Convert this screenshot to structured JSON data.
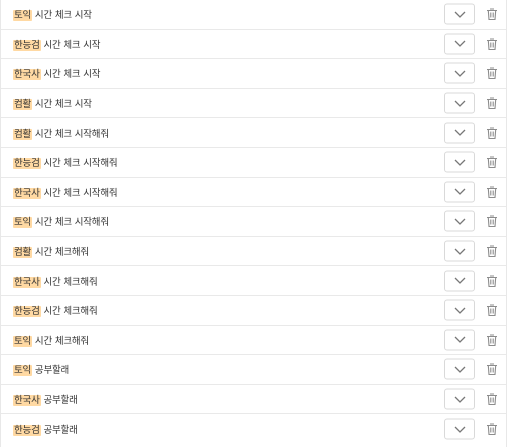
{
  "items": [
    {
      "tag": "토익",
      "text": " 시간 체크 시작"
    },
    {
      "tag": "한능검",
      "text": " 시간 체크 시작"
    },
    {
      "tag": "한국사",
      "text": " 시간 체크 시작"
    },
    {
      "tag": "컴활",
      "text": " 시간 체크 시작"
    },
    {
      "tag": "컴활",
      "text": " 시간 체크 시작해줘"
    },
    {
      "tag": "한능검",
      "text": " 시간 체크 시작해줘"
    },
    {
      "tag": "한국사",
      "text": " 시간 체크 시작해줘"
    },
    {
      "tag": "토익",
      "text": " 시간 체크 시작해줘"
    },
    {
      "tag": "컴활",
      "text": " 시간 체크해줘"
    },
    {
      "tag": "한국사",
      "text": " 시간 체크해줘"
    },
    {
      "tag": "한능검",
      "text": " 시간 체크해줘"
    },
    {
      "tag": "토익",
      "text": " 시간 체크해줘"
    },
    {
      "tag": "토익",
      "text": " 공부할래"
    },
    {
      "tag": "한국사",
      "text": " 공부할래"
    },
    {
      "tag": "한능검",
      "text": " 공부할래"
    }
  ],
  "icons": {
    "dropdown": "chevron-down-icon",
    "delete": "trash-icon"
  },
  "colors": {
    "highlight": "#ffd9a3",
    "text": "#333333",
    "border": "#d9d9d9",
    "icon": "#8c8c8c"
  }
}
